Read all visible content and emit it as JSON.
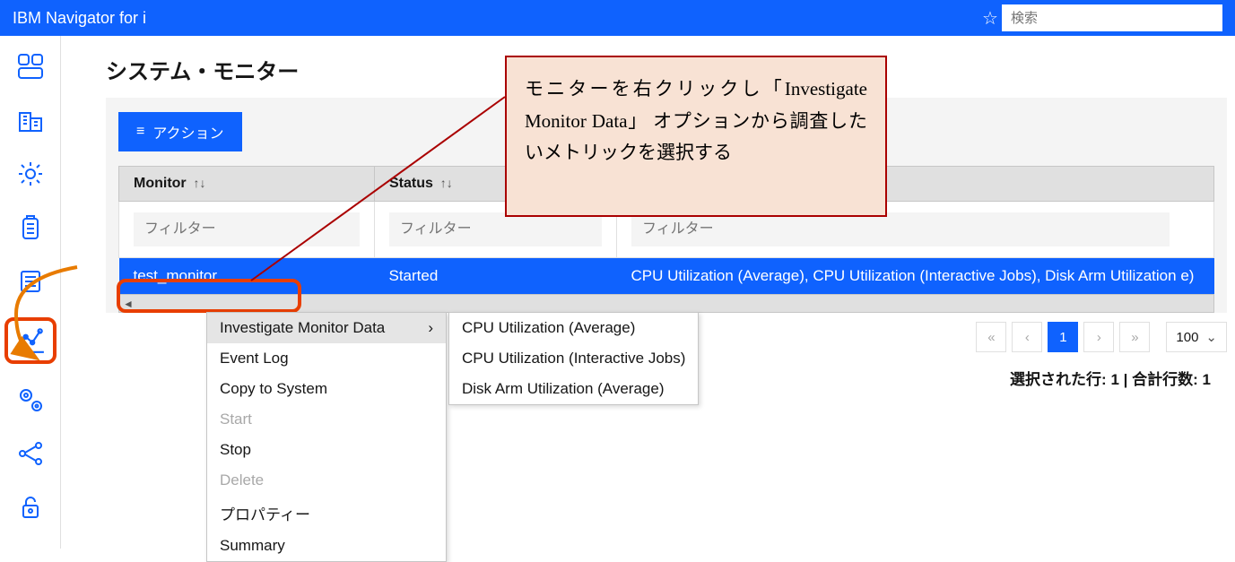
{
  "header": {
    "title": "IBM Navigator for i",
    "search_placeholder": "検索"
  },
  "sidebar": {
    "icons": [
      "dashboard-icon",
      "building-icon",
      "gear-icon",
      "battery-icon",
      "list-icon",
      "chart-icon",
      "gear-process-icon",
      "branch-icon",
      "lock-icon"
    ],
    "selected": "chart-icon"
  },
  "page": {
    "title": "システム・モニター",
    "actions_label": "アクション"
  },
  "table": {
    "columns": [
      "Monitor",
      "Status",
      ""
    ],
    "filter_placeholder": "フィルター",
    "rows": [
      {
        "monitor": "test_monitor",
        "status": "Started",
        "metrics": "CPU Utilization (Average), CPU Utilization (Interactive Jobs), Disk Arm Utilization e)"
      }
    ]
  },
  "pagination": {
    "current": "1",
    "page_size": "100"
  },
  "status": {
    "selected_label": "選択された行:",
    "selected_value": "1",
    "separator": " | ",
    "total_label": "合計行数:",
    "total_value": "1"
  },
  "context_menu": {
    "items": [
      {
        "label": "Investigate Monitor Data",
        "has_submenu": true,
        "highlight": true
      },
      {
        "label": "Event Log"
      },
      {
        "label": "Copy to System"
      },
      {
        "label": "Start",
        "disabled": true
      },
      {
        "label": "Stop"
      },
      {
        "label": "Delete",
        "disabled": true
      },
      {
        "label": "プロパティー"
      },
      {
        "label": "Summary"
      }
    ],
    "submenu": [
      "CPU Utilization (Average)",
      "CPU Utilization (Interactive Jobs)",
      "Disk Arm Utilization (Average)"
    ]
  },
  "callout": {
    "text": "モニターを右クリックし「Investigate Monitor Data」 オプションから調査したいメトリックを選択する"
  }
}
